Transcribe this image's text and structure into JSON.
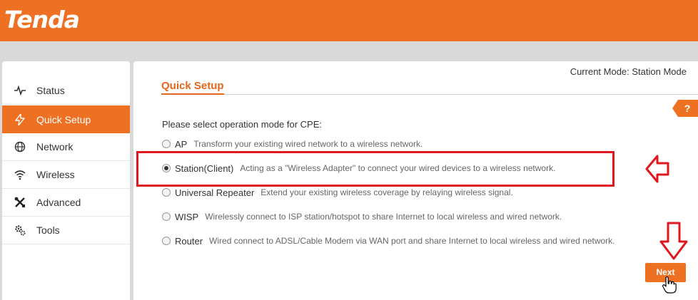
{
  "brand": {
    "logo_text": "Tenda"
  },
  "sidebar": {
    "items": [
      {
        "label": "Status",
        "icon": "pulse-icon",
        "active": false
      },
      {
        "label": "Quick Setup",
        "icon": "lightning-icon",
        "active": true
      },
      {
        "label": "Network",
        "icon": "globe-icon",
        "active": false
      },
      {
        "label": "Wireless",
        "icon": "wifi-icon",
        "active": false
      },
      {
        "label": "Advanced",
        "icon": "tools-icon",
        "active": false
      },
      {
        "label": "Tools",
        "icon": "gears-icon",
        "active": false
      }
    ]
  },
  "main": {
    "current_mode": "Current Mode: Station Mode",
    "title": "Quick Setup",
    "help_label": "?",
    "prompt": "Please select operation mode for CPE:",
    "options": [
      {
        "label": "AP",
        "desc": "Transform your existing wired network to a wireless network.",
        "checked": false
      },
      {
        "label": "Station(Client)",
        "desc": "Acting as a \"Wireless Adapter\" to connect your wired devices to a wireless network.",
        "checked": true
      },
      {
        "label": "Universal Repeater",
        "desc": "Extend your existing wireless coverage by relaying wireless signal.",
        "checked": false
      },
      {
        "label": "WISP",
        "desc": "Wirelessly connect to ISP station/hotspot to share Internet to local wireless and wired network.",
        "checked": false
      },
      {
        "label": "Router",
        "desc": "Wired connect to ADSL/Cable Modem via WAN port and share Internet to local wireless and wired network.",
        "checked": false
      }
    ],
    "next_label": "Next"
  },
  "colors": {
    "brand": "#ee7123",
    "annotation": "#e1171d"
  }
}
